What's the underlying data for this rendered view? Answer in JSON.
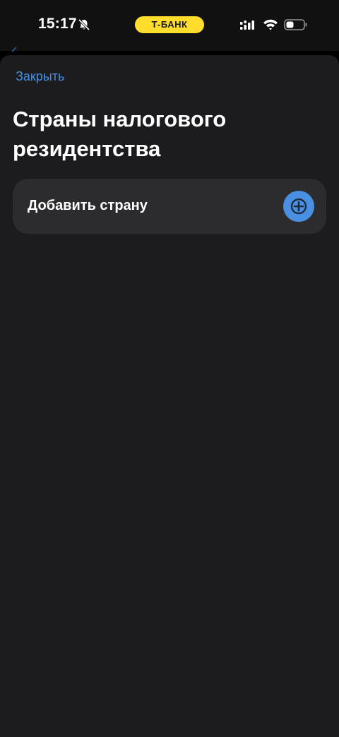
{
  "status_bar": {
    "time": "15:17",
    "brand": "Т-БАНК",
    "icons": [
      "bell-muted-icon",
      "signal-icon",
      "wifi-icon",
      "battery-icon"
    ]
  },
  "header": {
    "close_label": "Закрыть",
    "title": "Страны налогового резидентства"
  },
  "actions": {
    "add_country_label": "Добавить страну",
    "add_icon": "plus-icon"
  },
  "colors": {
    "accent": "#4a90e2",
    "brand_yellow": "#ffdd2d",
    "sheet_bg": "#1c1c1e",
    "card_bg": "#2c2c2e"
  }
}
